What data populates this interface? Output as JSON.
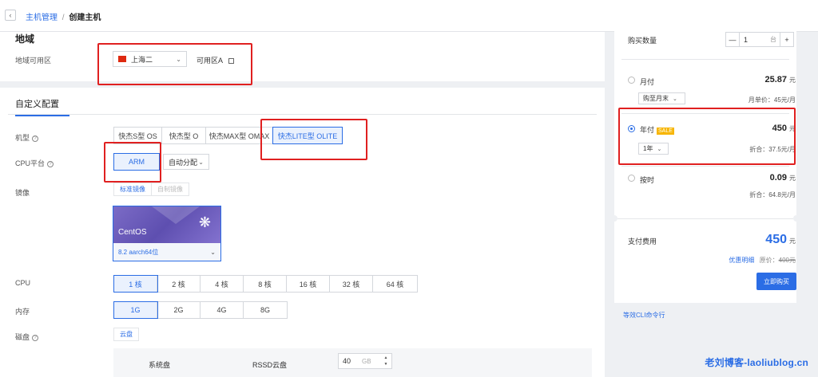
{
  "breadcrumb": {
    "back_icon": "chevron-left-icon",
    "parent": "主机管理",
    "separator": "/",
    "current": "创建主机"
  },
  "region": {
    "title": "地域",
    "label": "地域可用区",
    "city": "上海二",
    "zone": "可用区A",
    "zone_icon": "external-link-icon"
  },
  "config": {
    "tab": "自定义配置",
    "model": {
      "label": "机型",
      "options": [
        "快杰S型 OS",
        "快杰型 O",
        "快杰MAX型 OMAX",
        "快杰LITE型 OLITE"
      ],
      "selected": 3
    },
    "cpu_platform": {
      "label": "CPU平台",
      "value": "ARM",
      "alloc": "自动分配"
    },
    "image": {
      "label": "镜像",
      "tabs": [
        "标准镜像",
        "自制镜像"
      ],
      "os_name": "CentOS",
      "os_version": "8.2 aarch64位"
    },
    "cpu": {
      "label": "CPU",
      "options": [
        "1 核",
        "2 核",
        "4 核",
        "8 核",
        "16 核",
        "32 核",
        "64 核"
      ],
      "selected": 0
    },
    "memory": {
      "label": "内存",
      "options": [
        "1G",
        "2G",
        "4G",
        "8G"
      ],
      "selected": 0
    },
    "disk": {
      "label": "磁盘",
      "tab": "云盘",
      "system_disk": "系统盘",
      "disk_type": "RSSD云盘",
      "size": "40",
      "unit": "GB"
    }
  },
  "order": {
    "qty_label": "购买数量",
    "qty_value": "1",
    "qty_unit": "台",
    "minus": "—",
    "plus": "+",
    "monthly": {
      "name": "月付",
      "price": "25.87",
      "unit": "元",
      "period": "购至月末",
      "note": "月单价：45元/月"
    },
    "yearly": {
      "name": "年付",
      "badge": "SALE",
      "price": "450",
      "unit": "元",
      "period": "1年",
      "note": "折合：37.5元/月"
    },
    "hourly": {
      "name": "按时",
      "price": "0.09",
      "unit": "元",
      "note": "折合：64.8元/月"
    },
    "pay_label": "支付费用",
    "pay_price": "450",
    "pay_unit": "元",
    "detail_link": "优惠明细",
    "orig_label": "原价：",
    "orig_price": "400元",
    "buy_button": "立即购买",
    "cli_link": "等效CLI命令行"
  },
  "watermark": "老刘博客-laoliublog.cn"
}
